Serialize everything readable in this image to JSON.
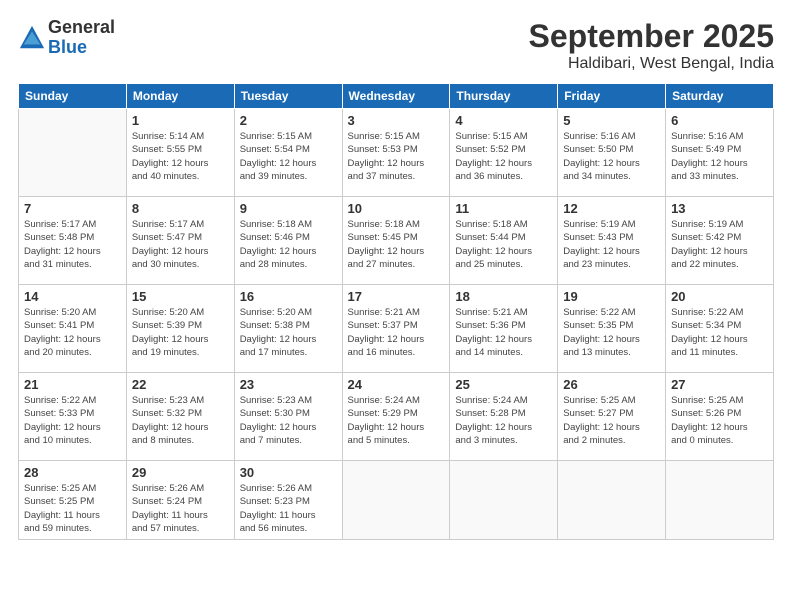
{
  "logo": {
    "general": "General",
    "blue": "Blue"
  },
  "title": "September 2025",
  "location": "Haldibari, West Bengal, India",
  "days_header": [
    "Sunday",
    "Monday",
    "Tuesday",
    "Wednesday",
    "Thursday",
    "Friday",
    "Saturday"
  ],
  "weeks": [
    [
      {
        "num": "",
        "info": ""
      },
      {
        "num": "1",
        "info": "Sunrise: 5:14 AM\nSunset: 5:55 PM\nDaylight: 12 hours\nand 40 minutes."
      },
      {
        "num": "2",
        "info": "Sunrise: 5:15 AM\nSunset: 5:54 PM\nDaylight: 12 hours\nand 39 minutes."
      },
      {
        "num": "3",
        "info": "Sunrise: 5:15 AM\nSunset: 5:53 PM\nDaylight: 12 hours\nand 37 minutes."
      },
      {
        "num": "4",
        "info": "Sunrise: 5:15 AM\nSunset: 5:52 PM\nDaylight: 12 hours\nand 36 minutes."
      },
      {
        "num": "5",
        "info": "Sunrise: 5:16 AM\nSunset: 5:50 PM\nDaylight: 12 hours\nand 34 minutes."
      },
      {
        "num": "6",
        "info": "Sunrise: 5:16 AM\nSunset: 5:49 PM\nDaylight: 12 hours\nand 33 minutes."
      }
    ],
    [
      {
        "num": "7",
        "info": "Sunrise: 5:17 AM\nSunset: 5:48 PM\nDaylight: 12 hours\nand 31 minutes."
      },
      {
        "num": "8",
        "info": "Sunrise: 5:17 AM\nSunset: 5:47 PM\nDaylight: 12 hours\nand 30 minutes."
      },
      {
        "num": "9",
        "info": "Sunrise: 5:18 AM\nSunset: 5:46 PM\nDaylight: 12 hours\nand 28 minutes."
      },
      {
        "num": "10",
        "info": "Sunrise: 5:18 AM\nSunset: 5:45 PM\nDaylight: 12 hours\nand 27 minutes."
      },
      {
        "num": "11",
        "info": "Sunrise: 5:18 AM\nSunset: 5:44 PM\nDaylight: 12 hours\nand 25 minutes."
      },
      {
        "num": "12",
        "info": "Sunrise: 5:19 AM\nSunset: 5:43 PM\nDaylight: 12 hours\nand 23 minutes."
      },
      {
        "num": "13",
        "info": "Sunrise: 5:19 AM\nSunset: 5:42 PM\nDaylight: 12 hours\nand 22 minutes."
      }
    ],
    [
      {
        "num": "14",
        "info": "Sunrise: 5:20 AM\nSunset: 5:41 PM\nDaylight: 12 hours\nand 20 minutes."
      },
      {
        "num": "15",
        "info": "Sunrise: 5:20 AM\nSunset: 5:39 PM\nDaylight: 12 hours\nand 19 minutes."
      },
      {
        "num": "16",
        "info": "Sunrise: 5:20 AM\nSunset: 5:38 PM\nDaylight: 12 hours\nand 17 minutes."
      },
      {
        "num": "17",
        "info": "Sunrise: 5:21 AM\nSunset: 5:37 PM\nDaylight: 12 hours\nand 16 minutes."
      },
      {
        "num": "18",
        "info": "Sunrise: 5:21 AM\nSunset: 5:36 PM\nDaylight: 12 hours\nand 14 minutes."
      },
      {
        "num": "19",
        "info": "Sunrise: 5:22 AM\nSunset: 5:35 PM\nDaylight: 12 hours\nand 13 minutes."
      },
      {
        "num": "20",
        "info": "Sunrise: 5:22 AM\nSunset: 5:34 PM\nDaylight: 12 hours\nand 11 minutes."
      }
    ],
    [
      {
        "num": "21",
        "info": "Sunrise: 5:22 AM\nSunset: 5:33 PM\nDaylight: 12 hours\nand 10 minutes."
      },
      {
        "num": "22",
        "info": "Sunrise: 5:23 AM\nSunset: 5:32 PM\nDaylight: 12 hours\nand 8 minutes."
      },
      {
        "num": "23",
        "info": "Sunrise: 5:23 AM\nSunset: 5:30 PM\nDaylight: 12 hours\nand 7 minutes."
      },
      {
        "num": "24",
        "info": "Sunrise: 5:24 AM\nSunset: 5:29 PM\nDaylight: 12 hours\nand 5 minutes."
      },
      {
        "num": "25",
        "info": "Sunrise: 5:24 AM\nSunset: 5:28 PM\nDaylight: 12 hours\nand 3 minutes."
      },
      {
        "num": "26",
        "info": "Sunrise: 5:25 AM\nSunset: 5:27 PM\nDaylight: 12 hours\nand 2 minutes."
      },
      {
        "num": "27",
        "info": "Sunrise: 5:25 AM\nSunset: 5:26 PM\nDaylight: 12 hours\nand 0 minutes."
      }
    ],
    [
      {
        "num": "28",
        "info": "Sunrise: 5:25 AM\nSunset: 5:25 PM\nDaylight: 11 hours\nand 59 minutes."
      },
      {
        "num": "29",
        "info": "Sunrise: 5:26 AM\nSunset: 5:24 PM\nDaylight: 11 hours\nand 57 minutes."
      },
      {
        "num": "30",
        "info": "Sunrise: 5:26 AM\nSunset: 5:23 PM\nDaylight: 11 hours\nand 56 minutes."
      },
      {
        "num": "",
        "info": ""
      },
      {
        "num": "",
        "info": ""
      },
      {
        "num": "",
        "info": ""
      },
      {
        "num": "",
        "info": ""
      }
    ]
  ]
}
